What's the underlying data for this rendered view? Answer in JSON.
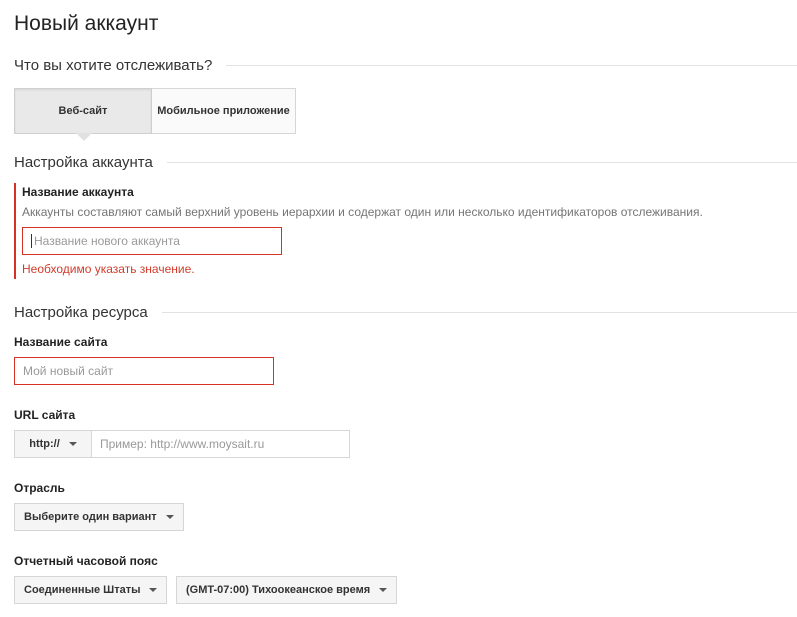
{
  "page_title": "Новый аккаунт",
  "sections": {
    "track": "Что вы хотите отслеживать?",
    "account": "Настройка аккаунта",
    "property": "Настройка ресурса"
  },
  "track_options": {
    "website": "Веб-сайт",
    "mobile_app": "Мобильное приложение"
  },
  "account": {
    "name_label": "Название аккаунта",
    "help": "Аккаунты составляют самый верхний уровень иерархии и содержат один или несколько идентификаторов отслеживания.",
    "name_placeholder": "Название нового аккаунта",
    "error": "Необходимо указать значение."
  },
  "property": {
    "site_name_label": "Название сайта",
    "site_name_placeholder": "Мой новый сайт",
    "url_label": "URL сайта",
    "protocol": "http://",
    "url_placeholder": "Пример: http://www.moysait.ru",
    "industry_label": "Отрасль",
    "industry_value": "Выберите один вариант",
    "timezone_label": "Отчетный часовой пояс",
    "country_value": "Соединенные Штаты",
    "timezone_value": "(GMT-07:00) Тихоокеанское время"
  },
  "colors": {
    "error": "#d93025",
    "error_text": "#d23c2a",
    "border": "#d6d6d6"
  }
}
